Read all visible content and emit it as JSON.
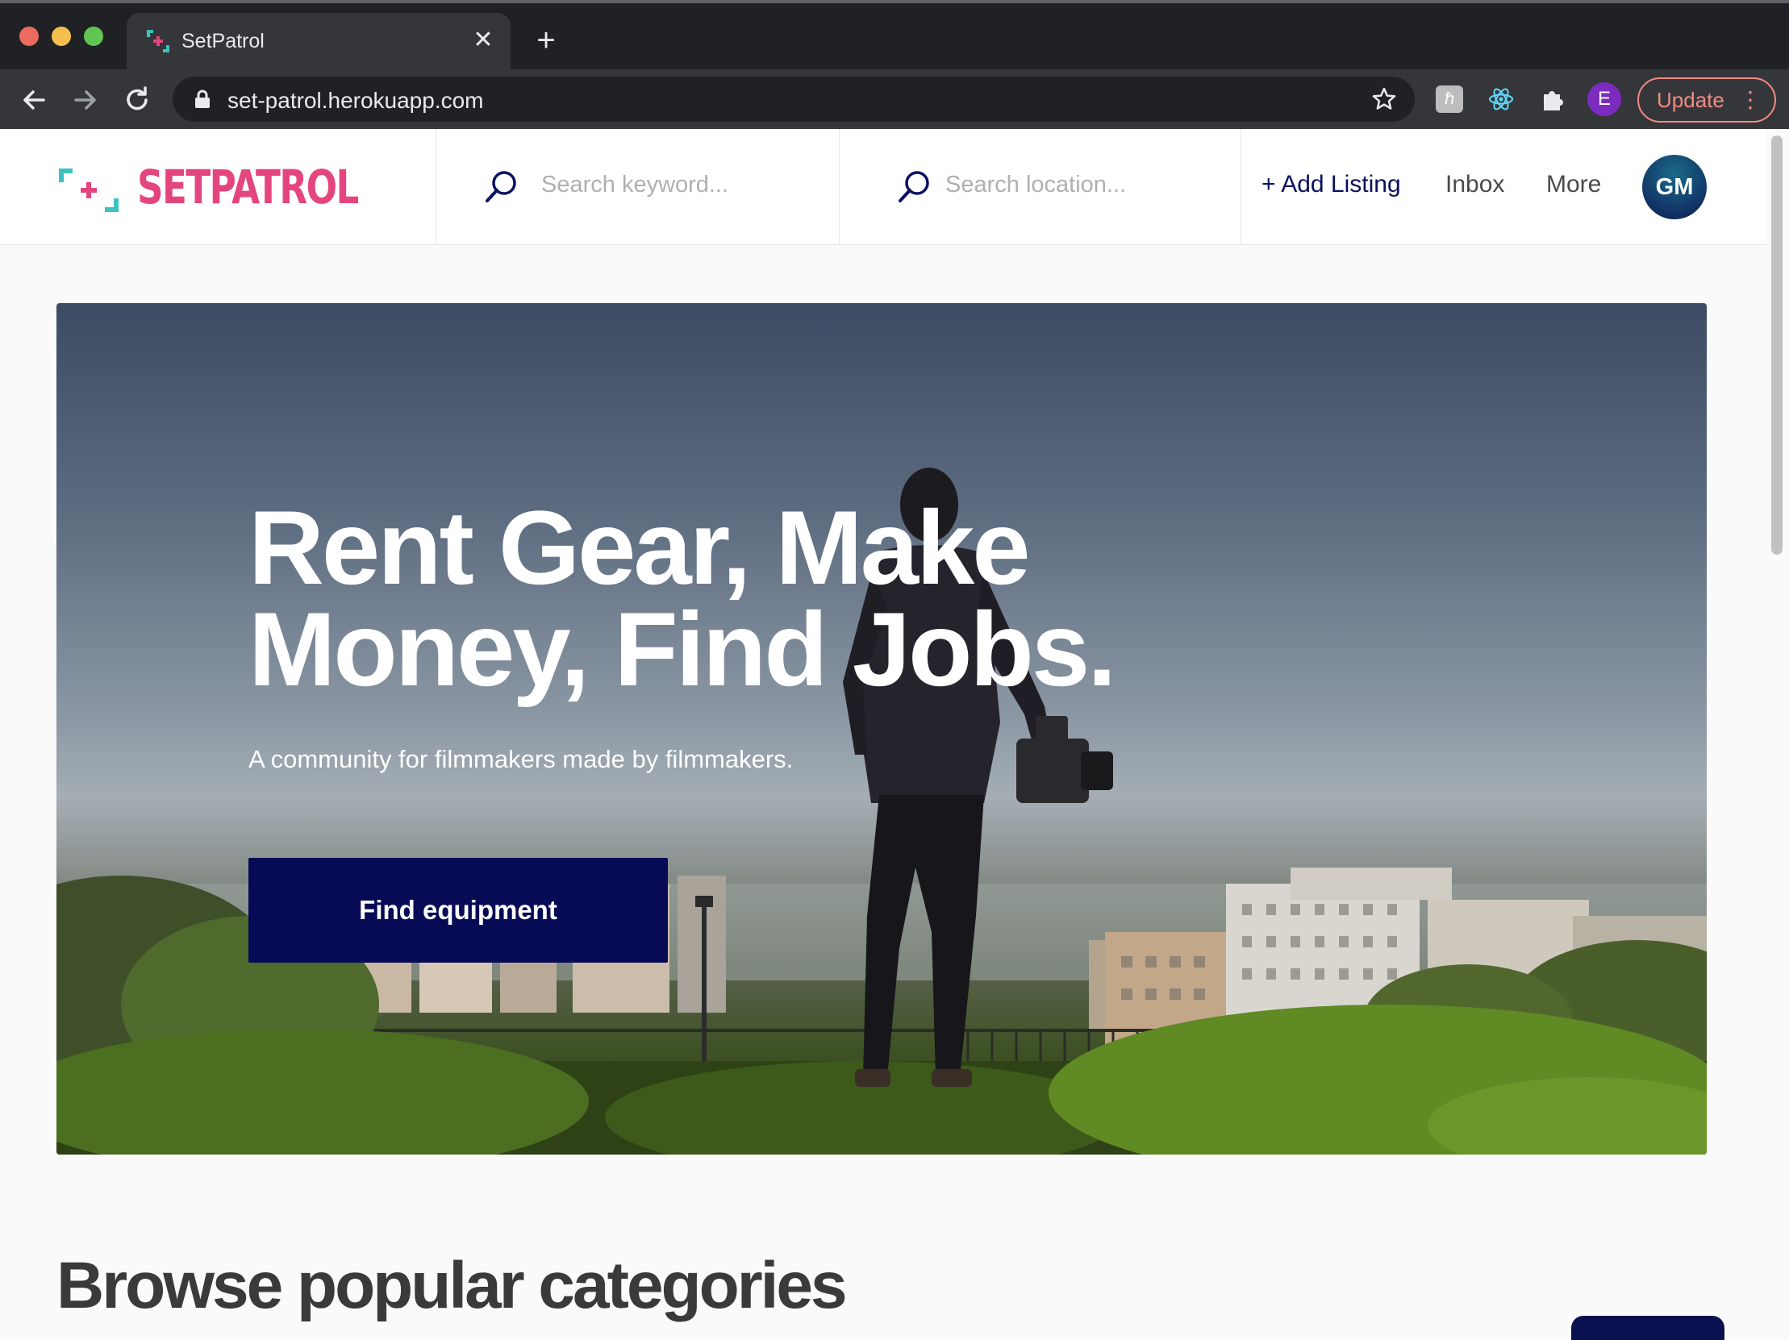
{
  "browser": {
    "tab": {
      "title": "SetPatrol"
    },
    "new_tab_symbol": "+",
    "close_symbol": "✕",
    "address": "set-patrol.herokuapp.com",
    "profile_initial": "E",
    "update_label": "Update",
    "menu_symbol": "⋮",
    "ext_symbol": "ℏ"
  },
  "header": {
    "logo_text": "SETPATROL",
    "search_keyword_placeholder": "Search keyword...",
    "search_location_placeholder": "Search location...",
    "add_listing": "+ Add Listing",
    "inbox": "Inbox",
    "more": "More",
    "avatar_initials": "GM"
  },
  "hero": {
    "title_line1": "Rent Gear, Make",
    "title_line2": "Money, Find Jobs.",
    "subtitle": "A community for filmmakers made by filmmakers.",
    "cta": "Find equipment"
  },
  "categories": {
    "title": "Browse popular categories"
  },
  "colors": {
    "brand_pink": "#e5457e",
    "brand_teal": "#3cc2bf",
    "brand_navy": "#070b55"
  }
}
